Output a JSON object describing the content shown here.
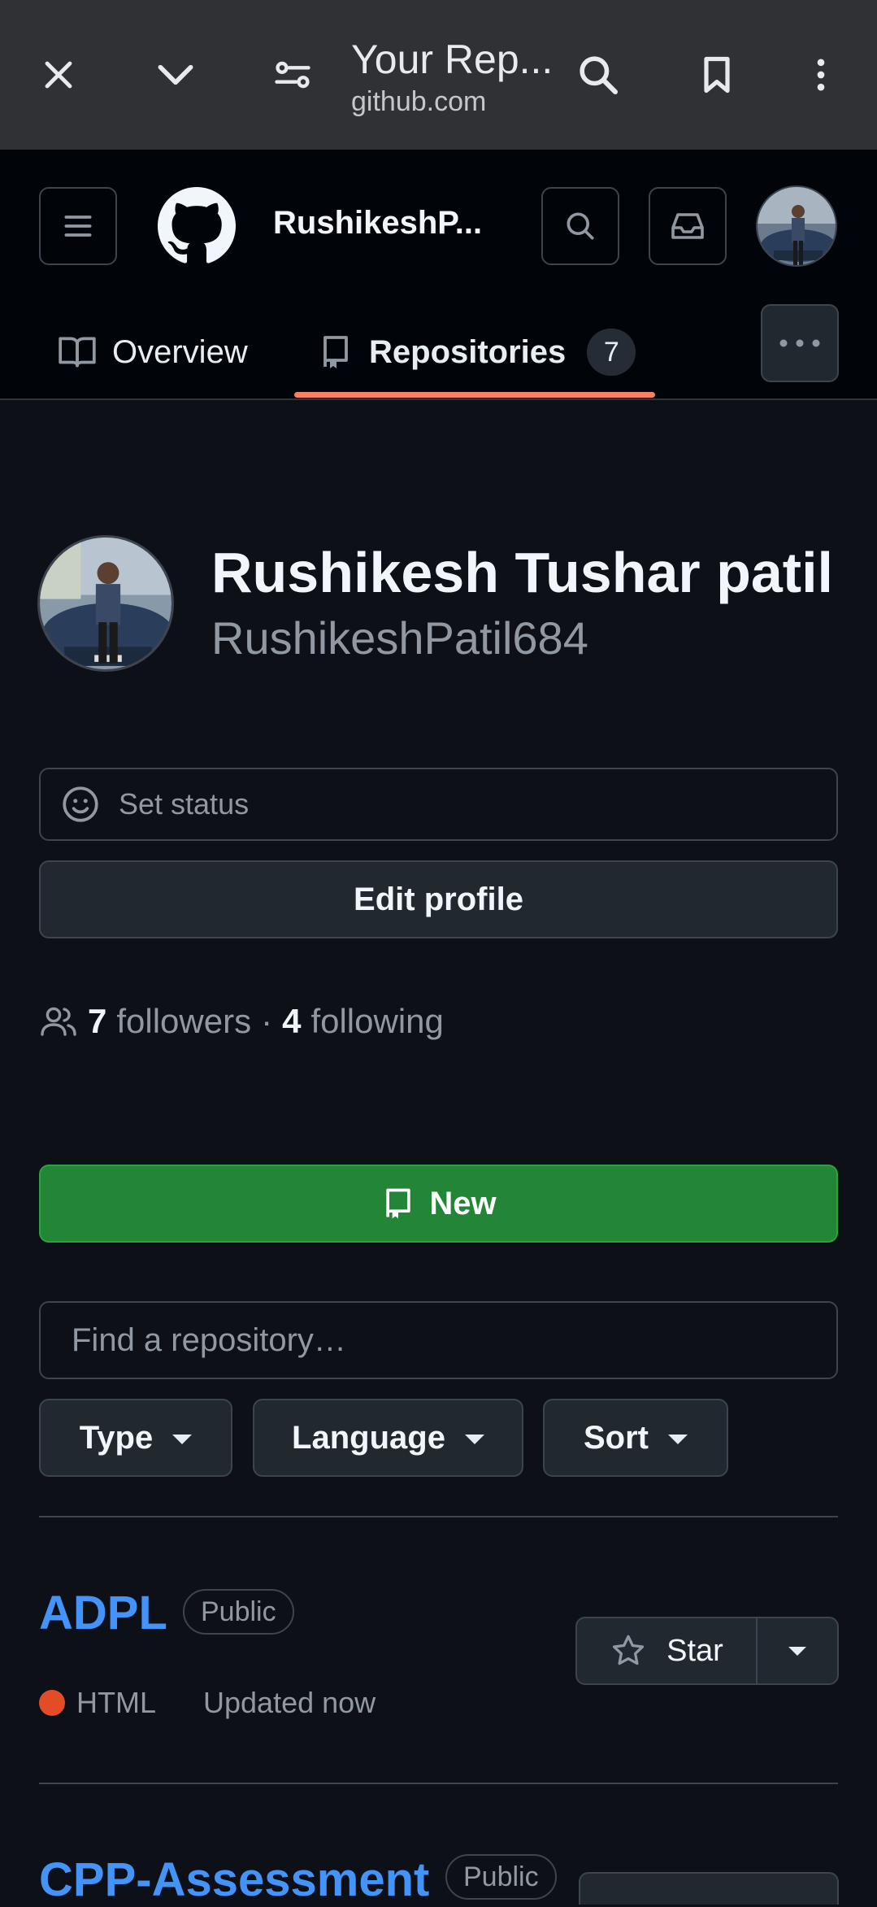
{
  "browser": {
    "title": "Your Rep...",
    "url": "github.com"
  },
  "header": {
    "username": "RushikeshP..."
  },
  "tabs": {
    "overview": "Overview",
    "repositories": "Repositories",
    "repo_count": "7"
  },
  "profile": {
    "full_name": "Rushikesh Tushar patil",
    "login": "RushikeshPatil684",
    "status_label": "Set status",
    "edit_label": "Edit profile",
    "followers_count": "7",
    "followers_label": "followers",
    "separator": "·",
    "following_count": "4",
    "following_label": "following"
  },
  "repos_toolbar": {
    "new_label": "New",
    "find_placeholder": "Find a repository…",
    "type_label": "Type",
    "language_label": "Language",
    "sort_label": "Sort"
  },
  "repos": [
    {
      "name": "ADPL",
      "visibility": "Public",
      "language": "HTML",
      "language_color": "#e34c26",
      "updated": "Updated now",
      "star_label": "Star"
    },
    {
      "name": "CPP-Assessment",
      "visibility": "Public"
    }
  ],
  "colors": {
    "accent_link": "#4493f8",
    "new_button": "#238636",
    "tab_underline": "#f78166"
  }
}
